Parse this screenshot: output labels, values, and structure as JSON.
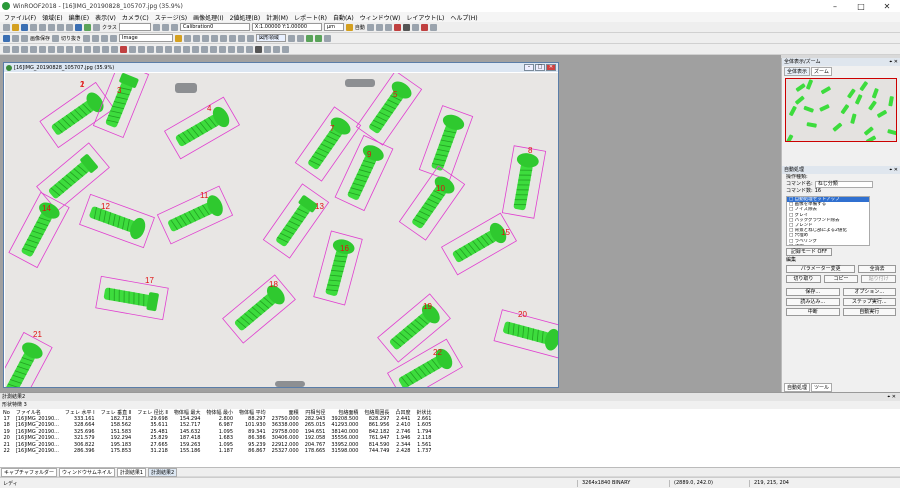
{
  "window": {
    "title": "WinROOF2018 - [16]IMG_20190828_105707.jpg (35.9%)",
    "minimize": "–",
    "maximize": "□",
    "close": "✕"
  },
  "menu": [
    "ファイル(F)",
    "領域(E)",
    "編集(E)",
    "表示(V)",
    "カメラ(C)",
    "ステージ(S)",
    "画像処理(I)",
    "2値処理(B)",
    "計測(M)",
    "レポート(R)",
    "自動(A)",
    "ウィンドウ(W)",
    "レイアウト(L)",
    "ヘルプ(H)"
  ],
  "toolbar": {
    "class_label": "クラス",
    "calibration": "Calibration0",
    "scale": "X:1.00000  Y:1.00000",
    "unit": "μm",
    "auto_label": "自動",
    "image_mode": "Image",
    "region_label": "図形領域",
    "mark_label": "画像保存",
    "cut_label": "切り抜き"
  },
  "image_window": {
    "title": "[16]IMG_20190828_105707.jpg (35.9%)"
  },
  "labels": [
    "1",
    "2",
    "3",
    "4",
    "5",
    "6",
    "7",
    "8",
    "9",
    "10",
    "11",
    "12",
    "13",
    "14",
    "15",
    "16",
    "17",
    "18",
    "19",
    "20",
    "21",
    "22"
  ],
  "right_panel": {
    "overview_title": "全体表示/ズーム",
    "tab_overview": "全体表示",
    "tab_zoom": "ズーム",
    "auto_title": "自動処理",
    "operation_label": "操作種類:",
    "command_name_label": "コマンド名:",
    "command_name_value": "ねじ分類",
    "command_count_label": "コマンド数:",
    "command_count_value": "16",
    "commands": [
      "□ 自動処理セットアップ",
      "□ 画像を準備する",
      "□ ノイズ除去",
      "□ グレイ",
      "□ バックグラウンド除去",
      "□ ブレンド",
      "□ 背景とねじ部による2値化",
      "□ 穴埋め",
      "□ ラベリング",
      "□ 計測"
    ],
    "record_mode": "記録モード OFF",
    "edit_label": "編集",
    "btn_param": "パラメーター変更",
    "btn_delete_all": "全消去",
    "btn_cut": "切り取り",
    "btn_copy": "コピー",
    "btn_paste": "貼り付け",
    "btn_save": "保存...",
    "btn_option": "オプション...",
    "btn_load": "読み込み...",
    "btn_step": "ステップ実行...",
    "btn_stop": "中断",
    "btn_autorun": "自動実行",
    "footer_auto": "自動処理",
    "footer_tool": "ツール"
  },
  "results": {
    "panel_title": "計測結果2",
    "tab": "形状特徴 3",
    "columns": [
      "No",
      "ファイル名",
      "フェレ 水平 Ⅰ",
      "フェレ 垂直 Ⅱ",
      "フェレ 径比 Ⅱ",
      "物体幅 最大",
      "物体幅 最小",
      "物体幅 平均",
      "面積",
      "円相当径",
      "包絡面積",
      "包絡周囲長",
      "凸凹度",
      "針状比"
    ],
    "rows": [
      [
        "17",
        "[16]IMG_20190...",
        "333.161",
        "182.718",
        "29.698",
        "154.294",
        "2.800",
        "88.297",
        "23750.000",
        "282.943",
        "39208.500",
        "828.297",
        "2.441",
        "2.661"
      ],
      [
        "18",
        "[16]IMG_20190...",
        "328.664",
        "158.562",
        "35.611",
        "152.717",
        "6.987",
        "101.930",
        "36338.000",
        "265.015",
        "41293.000",
        "861.956",
        "2.410",
        "1.605"
      ],
      [
        "19",
        "[16]IMG_20190...",
        "325.696",
        "151.583",
        "25.481",
        "145.632",
        "1.095",
        "89.341",
        "29758.000",
        "194.651",
        "38140.000",
        "842.182",
        "2.746",
        "1.794"
      ],
      [
        "20",
        "[16]IMG_20190...",
        "321.579",
        "192.294",
        "25.829",
        "187.418",
        "1.683",
        "86.386",
        "30406.000",
        "192.058",
        "35556.000",
        "761.947",
        "1.946",
        "2.118"
      ],
      [
        "21",
        "[16]IMG_20190...",
        "306.822",
        "195.183",
        "27.665",
        "159.263",
        "1.095",
        "95.239",
        "22912.000",
        "204.767",
        "33952.000",
        "814.590",
        "2.344",
        "1.561"
      ],
      [
        "22",
        "[16]IMG_20190...",
        "286.396",
        "175.853",
        "31.218",
        "155.186",
        "1.187",
        "86.867",
        "25327.000",
        "178.665",
        "31598.000",
        "744.749",
        "2.428",
        "1.737"
      ]
    ]
  },
  "bottom_tabs": [
    "キャプチャフォルダー",
    "ウィンドウサムネイル",
    "計測結果1",
    "計測結果2"
  ],
  "status": {
    "ready": "レディ",
    "image_info": "3264x1840 BINARY",
    "coords": "(2889.0, 242.0)",
    "rgb": "219, 215, 204"
  },
  "colors": {
    "screw": "#3ddc3d",
    "box": "#e040d0",
    "label": "#e01010"
  }
}
